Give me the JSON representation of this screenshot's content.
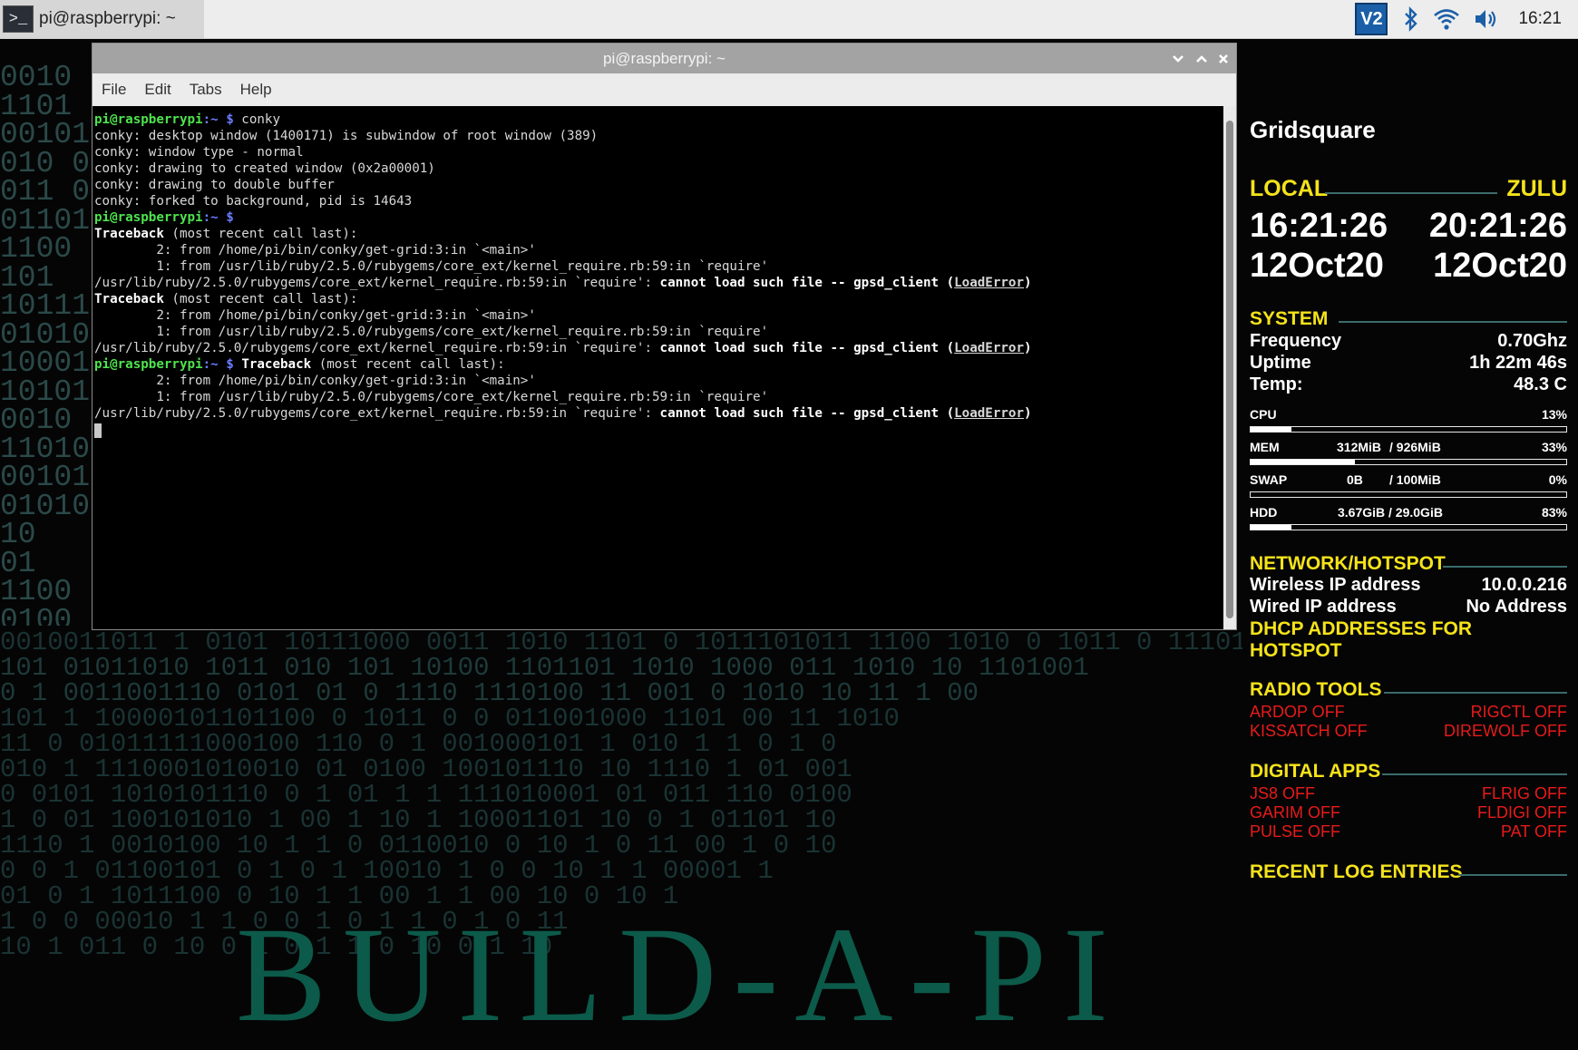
{
  "taskbar": {
    "task_title": "pi@raspberrypi: ~",
    "term_icon": ">_",
    "vnc_label": "V2",
    "clock": "16:21"
  },
  "terminal": {
    "title": "pi@raspberrypi: ~",
    "menu": [
      "File",
      "Edit",
      "Tabs",
      "Help"
    ],
    "prompt_user": "pi@raspberrypi",
    "prompt_path": ":~ $",
    "cmd1": " conky",
    "out1": "conky: desktop window (1400171) is subwindow of root window (389)",
    "out2": "conky: window type - normal",
    "out3": "conky: drawing to created window (0x2a00001)",
    "out4": "conky: drawing to double buffer",
    "out5": "conky: forked to background, pid is 14643",
    "tb_word": "Traceback",
    "tb_rest": " (most recent call last):",
    "frame2": "        2: from /home/pi/bin/conky/get-grid:3:in `<main>'",
    "frame1": "        1: from /usr/lib/ruby/2.5.0/rubygems/core_ext/kernel_require.rb:59:in `require'",
    "err_pre": "/usr/lib/ruby/2.5.0/rubygems/core_ext/kernel_require.rb:59:in `require': ",
    "err_bold": "cannot load such file -- gpsd_client (",
    "err_link": "LoadError",
    "err_end": ")"
  },
  "conky": {
    "gridsquare": "Gridsquare",
    "local_label": "LOCAL",
    "zulu_label": "ZULU",
    "local_time": "16:21:26",
    "zulu_time": "20:21:26",
    "local_date": "12Oct20",
    "zulu_date": "12Oct20",
    "system_label": "SYSTEM",
    "frequency_label": "Frequency",
    "frequency_value": "0.70Ghz",
    "uptime_label": "Uptime",
    "uptime_value": "1h 22m 46s",
    "temp_label": "Temp:",
    "temp_value": "48.3 C",
    "cpu_label": "CPU",
    "cpu_pct": "13%",
    "cpu_frac": 0.13,
    "mem_label": "MEM",
    "mem_used": "312MiB",
    "mem_total": "/ 926MiB",
    "mem_pct": "33%",
    "mem_frac": 0.33,
    "swap_label": "SWAP",
    "swap_used": "0B",
    "swap_total": "/ 100MiB",
    "swap_pct": "0%",
    "swap_frac": 0.0,
    "hdd_label": "HDD",
    "hdd_used": "3.67GiB / 29.0GiB",
    "hdd_pct": "83%",
    "hdd_frac": 0.13,
    "network_label": "NETWORK/HOTSPOT",
    "wireless_label": "Wireless IP address",
    "wireless_value": "10.0.0.216",
    "wired_label": "Wired IP address",
    "wired_value": "No Address",
    "dhcp_label": "DHCP ADDRESSES FOR HOTSPOT",
    "radio_label": "RADIO TOOLS",
    "ardop": "ARDOP OFF",
    "rigctl": "RIGCTL OFF",
    "kissattach": "KISSATCH OFF",
    "direwolf": "DIREWOLF OFF",
    "digital_label": "DIGITAL APPS",
    "js8": "JS8 OFF",
    "flrig": "FLRIG OFF",
    "garim": "GARIM OFF",
    "fldigi": "FLDIGI OFF",
    "pulse": "PULSE OFF",
    "pat": "PAT OFF",
    "log_label": "RECENT LOG ENTRIES"
  },
  "colors": {
    "section_yellow": "#f5e31a",
    "status_red": "#e81a1a",
    "prompt_green": "#4ee34e",
    "prompt_blue": "#6b7cff"
  }
}
